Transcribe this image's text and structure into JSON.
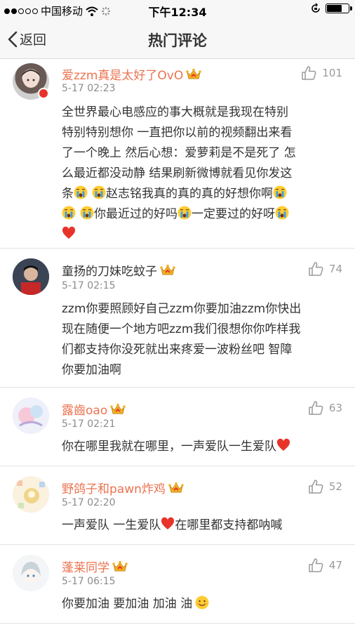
{
  "status_bar": {
    "carrier": "中国移动",
    "time": "下午12:34",
    "battery_level": 0.72
  },
  "nav": {
    "back_label": "返回",
    "title": "热门评论"
  },
  "comments": [
    {
      "username": "爱zzm真是太好了OvO",
      "time": "5-17 02:23",
      "likes": "101",
      "line1": "全世界最心电感应的事大概就是我现在特别",
      "line2": "特别特别想你 一直把你以前的视频翻出来看",
      "line3": "了一个晚上 然后心想：爱萝莉是不是死了 怎",
      "line4": "么最近都没动静 结果刷新微博就看见你发这",
      "line5a": "条",
      "line5b": "赵志铭我真的真的真的好想你啊",
      "line6a": "你最近过的好吗",
      "line6b": "一定要过的好呀"
    },
    {
      "username": "童扬的刀妹吃蚊子",
      "time": "5-17 02:15",
      "likes": "74",
      "line1": "zzm你要照顾好自己zzm你要加油zzm你快出",
      "line2": "现在随便一个地方吧zzm我们很想你你咋样我",
      "line3": "们都支持你没死就出来疼爱一波粉丝吧 智障",
      "line4": "你要加油啊"
    },
    {
      "username": "露齒oao",
      "time": "5-17 02:21",
      "likes": "63",
      "line1": "你在哪里我就在哪里，一声爱队一生爱队"
    },
    {
      "username": "野鸽子和pawn炸鸡",
      "time": "5-17 02:20",
      "likes": "52",
      "line1a": "一声爱队 一生爱队",
      "line1b": "在哪里都支持都呐喊"
    },
    {
      "username": "蓬莱同学",
      "time": "5-17 06:15",
      "likes": "47",
      "line1": "你要加油 要加油 加油 油"
    }
  ],
  "colors": {
    "username": "#eb7350",
    "meta": "#8c8c8c",
    "heart": "#e8332a"
  }
}
